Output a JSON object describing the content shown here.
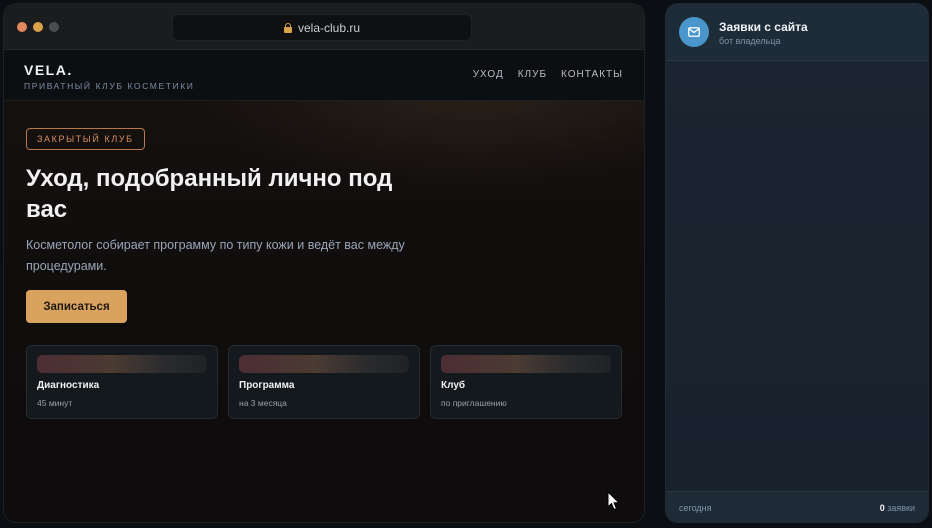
{
  "browser": {
    "url": "vela-club.ru"
  },
  "site": {
    "brand": {
      "name": "VELA.",
      "tagline": "ПРИВАТНЫЙ КЛУБ КОСМЕТИКИ"
    },
    "nav": [
      "УХОД",
      "КЛУБ",
      "КОНТАКТЫ"
    ],
    "hero": {
      "badge": "ЗАКРЫТЫЙ КЛУБ",
      "title": "Уход, подобранный лично под вас",
      "description": "Косметолог собирает программу по типу кожи и ведёт вас между процедурами.",
      "cta_label": "Записаться"
    },
    "cards": [
      {
        "title": "Диагностика",
        "subtitle": "45 минут"
      },
      {
        "title": "Программа",
        "subtitle": "на 3 месяца"
      },
      {
        "title": "Клуб",
        "subtitle": "по приглашению"
      }
    ]
  },
  "panel": {
    "avatar_icon": "mail-icon",
    "title": "Заявки с сайта",
    "subtitle": "бот владельца",
    "footer": {
      "left": "сегодня",
      "count": "0",
      "count_label": "заявки"
    }
  },
  "colors": {
    "accent": "#d9a35f",
    "badge_border": "#b7774a",
    "avatar": "#4a96cc"
  }
}
